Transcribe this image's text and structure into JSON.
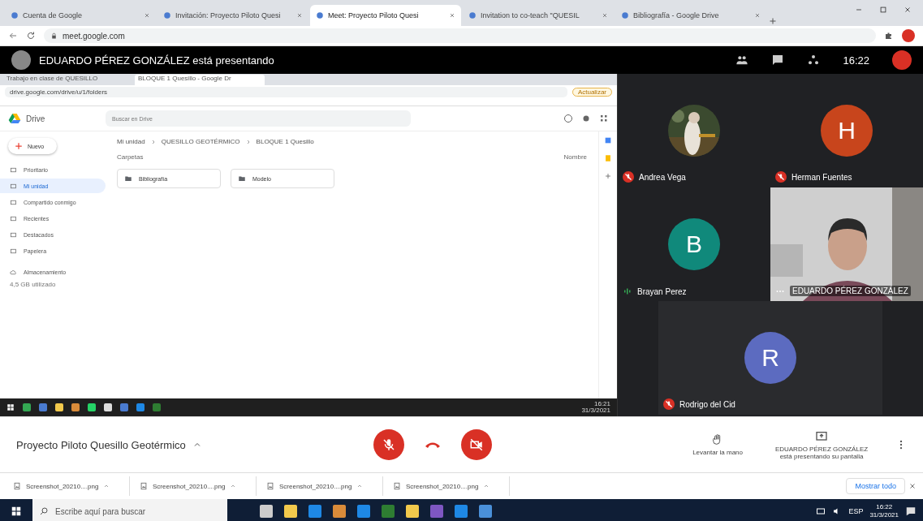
{
  "browser": {
    "tabs": [
      {
        "label": "Cuenta de Google",
        "selected": false
      },
      {
        "label": "Invitación: Proyecto Piloto Quesi",
        "selected": false
      },
      {
        "label": "Meet: Proyecto Piloto Quesi",
        "selected": true
      },
      {
        "label": "Invitation to co-teach \"QUESIL",
        "selected": false
      },
      {
        "label": "Bibliografía - Google Drive",
        "selected": false
      }
    ],
    "url": "meet.google.com"
  },
  "meet_header": {
    "presenter_text": "EDUARDO PÉREZ GONZÁLEZ está presentando",
    "time": "16:22"
  },
  "shared_screen": {
    "tabs": [
      {
        "label": "Trabajo en clase de QUESILLO",
        "selected": false
      },
      {
        "label": "BLOQUE 1 Quesillo - Google Dr",
        "selected": true
      }
    ],
    "url": "drive.google.com/drive/u/1/folders",
    "update_button": "Actualizar",
    "drive": {
      "logo_text": "Drive",
      "search_placeholder": "Buscar en Drive",
      "new_button": "Nuevo",
      "nav": [
        {
          "label": "Prioritario",
          "selected": false
        },
        {
          "label": "Mi unidad",
          "selected": true
        },
        {
          "label": "Compartido conmigo",
          "selected": false
        },
        {
          "label": "Recientes",
          "selected": false
        },
        {
          "label": "Destacados",
          "selected": false
        },
        {
          "label": "Papelera",
          "selected": false
        }
      ],
      "storage": "Almacenamiento",
      "storage_detail": "4,5 GB utilizado",
      "breadcrumb": [
        "Mi unidad",
        "QUESILLO GEOTÉRMICO",
        "BLOQUE 1 Quesillo"
      ],
      "section": "Carpetas",
      "sort": "Nombre",
      "folders": [
        "Bibliografía",
        "Modelo"
      ]
    },
    "taskbar_time": "16:21",
    "taskbar_date": "31/3/2021"
  },
  "participants": [
    {
      "name": "Andrea Vega",
      "muted": true,
      "speaking": false
    },
    {
      "name": "Herman Fuentes",
      "kind": "avatar",
      "initial": "H",
      "color": "#c8451c",
      "muted": true,
      "speaking": false
    },
    {
      "name": "Brayan Perez",
      "kind": "avatar",
      "initial": "B",
      "color": "#10897b",
      "muted": false,
      "speaking": true
    },
    {
      "name": "EDUARDO PÉREZ GONZÁLEZ",
      "kind": "video",
      "muted": false,
      "speaking": false
    },
    {
      "name": "Rodrigo del Cid",
      "kind": "avatar",
      "initial": "R",
      "color": "#5c6bc0",
      "muted": true,
      "speaking": false
    }
  ],
  "meeting_bar": {
    "title": "Proyecto Piloto Quesillo Geotérmico",
    "controls": [
      {
        "kind": "mic",
        "off": true
      },
      {
        "kind": "hangup",
        "off": false
      },
      {
        "kind": "camera",
        "off": true
      }
    ],
    "raise_hand": "Levantar la mano",
    "presenting": "EDUARDO PÉREZ GONZÁLEZ está presentando su pantalla"
  },
  "downloads": {
    "items": [
      "Screenshot_20210....png",
      "Screenshot_20210....png",
      "Screenshot_20210....png",
      "Screenshot_20210....png"
    ],
    "show_all": "Mostrar todo"
  },
  "taskbar": {
    "search_placeholder": "Escribe aquí para buscar",
    "language": "ESP",
    "time": "16:22",
    "date": "31/3/2021"
  }
}
